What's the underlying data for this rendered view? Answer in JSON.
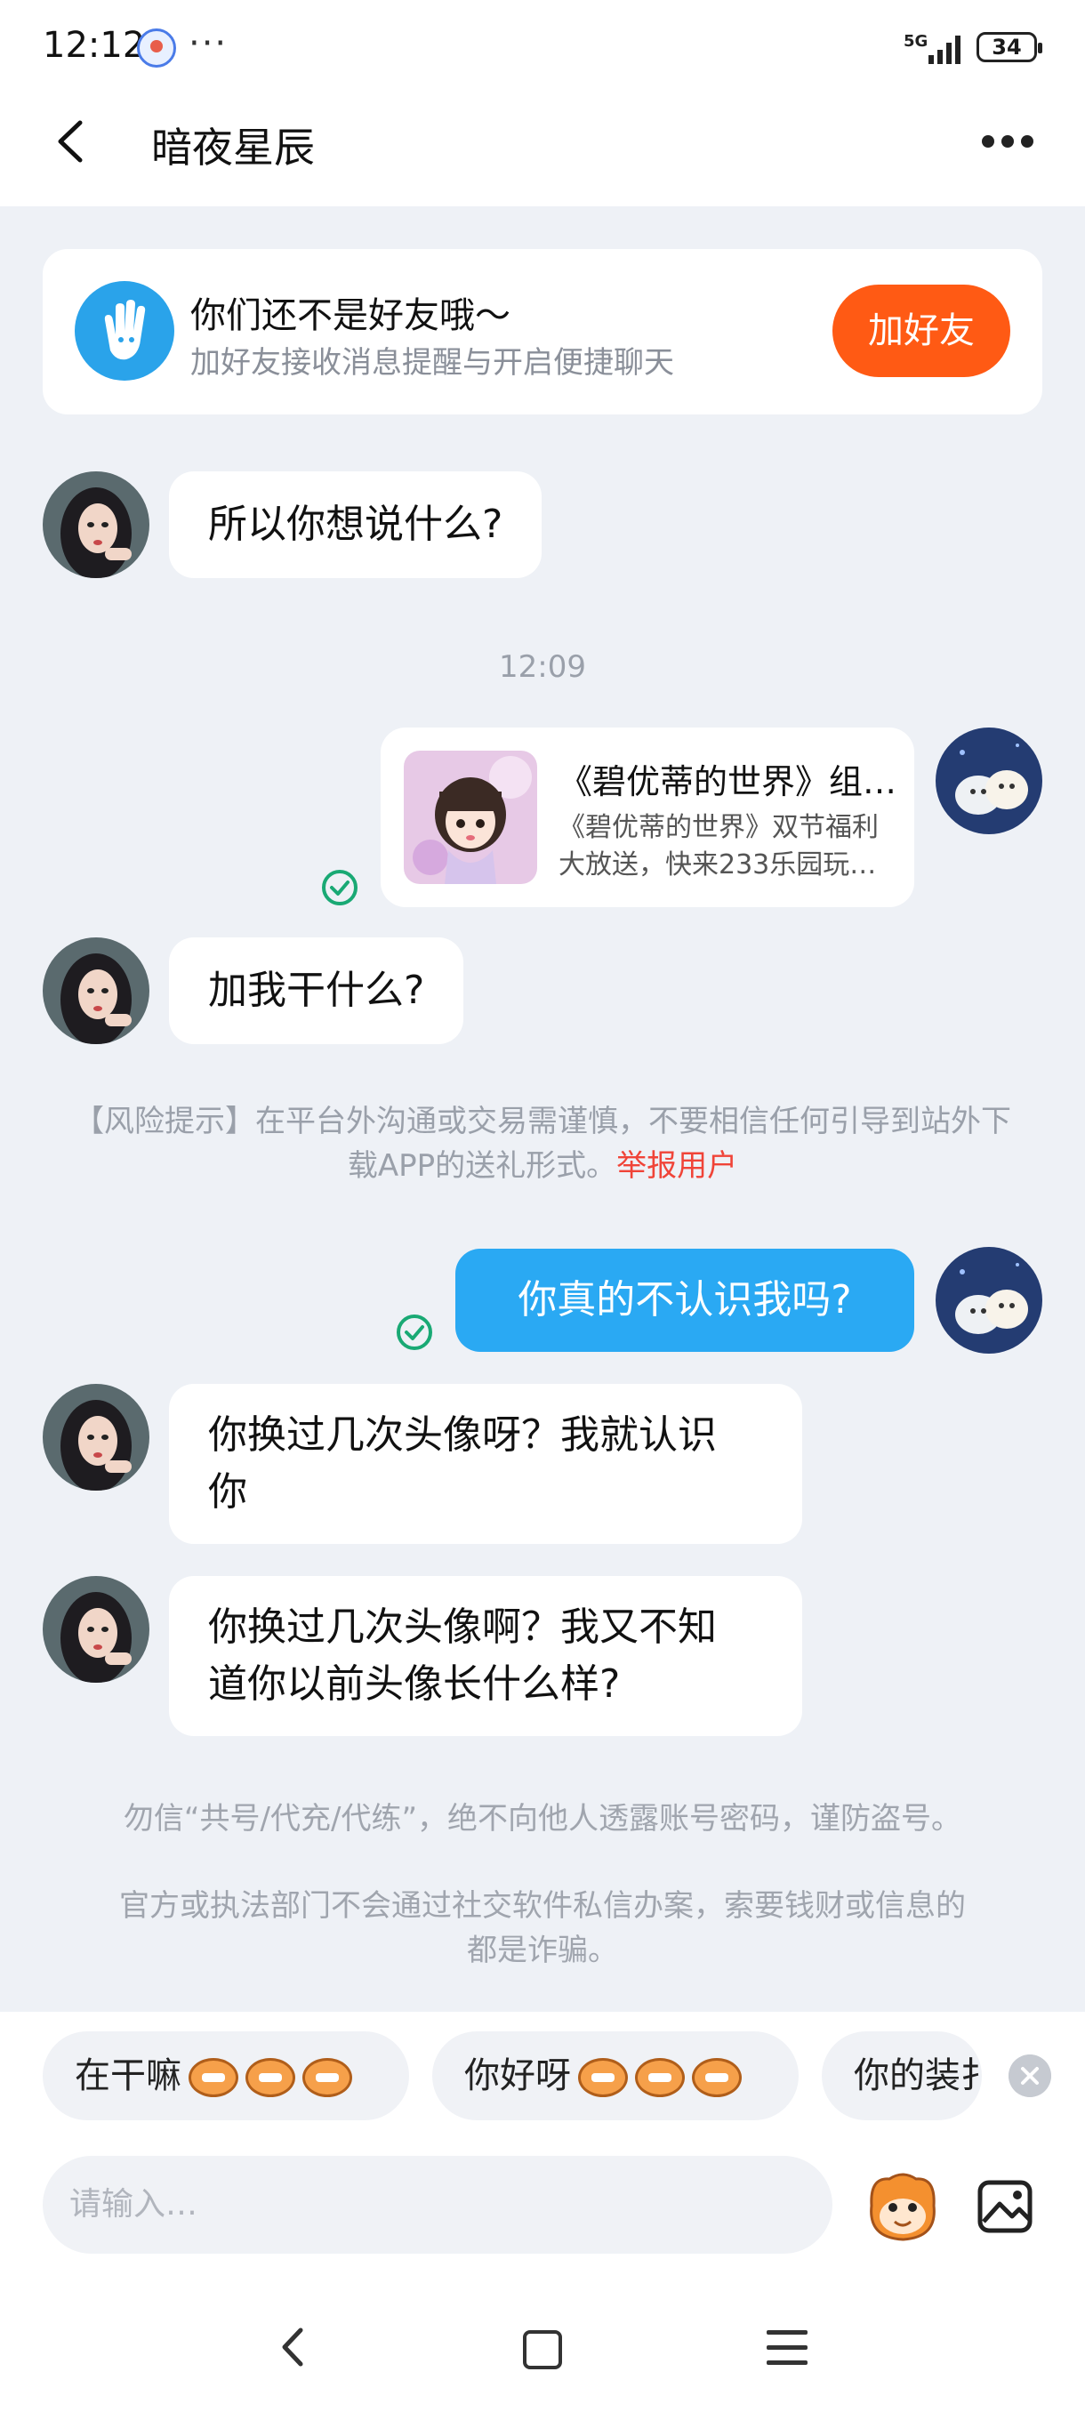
{
  "status_bar": {
    "time": "12:12",
    "dots": "···",
    "network": "5G",
    "battery": "34"
  },
  "header": {
    "title": "暗夜星辰"
  },
  "friend_banner": {
    "title": "你们还不是好友哦～",
    "subtitle": "加好友接收消息提醒与开启便捷聊天",
    "button": "加好友"
  },
  "messages": {
    "m1": "所以你想说什么?",
    "time1": "12:09",
    "card_title": "《碧优蒂的世界》组…",
    "card_desc_line1": "《碧优蒂的世界》双节福利",
    "card_desc_line2": "大放送，快来233乐园玩…",
    "m2": "加我干什么?",
    "risk_text": "【风险提示】在平台外沟通或交易需谨慎，不要相信任何引导到站外下载APP的送礼形式。",
    "risk_link": "举报用户",
    "mine1": "你真的不认识我吗?",
    "m3_line1": "你换过几次头像呀？我就认识",
    "m3_line2": "你",
    "m4_line1": "你换过几次头像啊？我又不知",
    "m4_line2": "道你以前头像长什么样?"
  },
  "notices": {
    "n1": "勿信“共号/代充/代练”，绝不向他人透露账号密码，谨防盗号。",
    "n2": "官方或执法部门不会通过社交软件私信办案，索要钱财或信息的都是诈骗。"
  },
  "quick_replies": [
    "在干嘛",
    "你好呀",
    "你的装扌"
  ],
  "input": {
    "placeholder": "请输入…"
  },
  "colors": {
    "accent_blue": "#2aa9f3",
    "accent_orange": "#ff5a14",
    "report_red": "#f04438",
    "check_green": "#19a974"
  }
}
